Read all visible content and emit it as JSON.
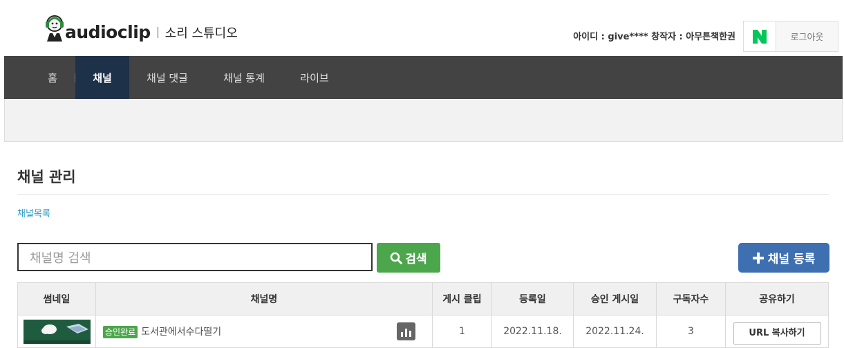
{
  "header": {
    "logo_text": "audioclip",
    "studio_text": "소리 스튜디오",
    "user_info": "아이디 : give**** 창작자 : 아무튼책한권",
    "naver_label": "N",
    "logout_label": "로그아웃"
  },
  "nav": {
    "items": [
      {
        "label": "홈"
      },
      {
        "label": "채널"
      },
      {
        "label": "채널 댓글"
      },
      {
        "label": "채널 통계"
      },
      {
        "label": "라이브"
      }
    ],
    "active": "채널"
  },
  "page": {
    "title": "채널 관리",
    "breadcrumb": "채널목록"
  },
  "search": {
    "placeholder": "채널명 검색",
    "button_label": "검색"
  },
  "register": {
    "button_label": "채널 등록"
  },
  "table": {
    "headers": [
      "썸네일",
      "채널명",
      "게시 클립",
      "등록일",
      "승인 게시일",
      "구독자수",
      "공유하기"
    ],
    "rows": [
      {
        "status": "승인완료",
        "name": "도서관에서수다떨기",
        "clips": "1",
        "registered": "2022.11.18.",
        "approved": "2022.11.24.",
        "subscribers": "3",
        "share_label": "URL 복사하기"
      }
    ]
  },
  "colors": {
    "nav_bg": "#434343",
    "nav_active": "#1d3148",
    "search_green": "#4ca64c",
    "register_blue": "#3e6fb0",
    "link_blue": "#2b9ac8",
    "naver_green": "#03c75a"
  },
  "icons": {
    "logo": "headphone-person-icon",
    "naver": "naver-n-icon",
    "search": "magnifier-icon",
    "register": "plus-icon",
    "stats": "bar-chart-icon"
  }
}
